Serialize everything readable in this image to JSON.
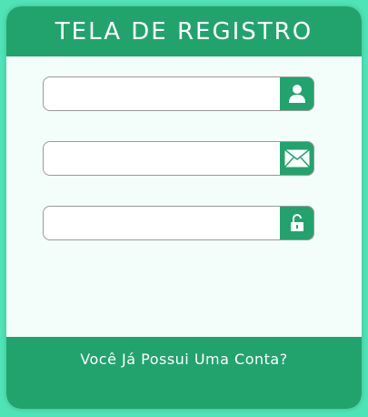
{
  "header": {
    "title": "TELA DE REGISTRO"
  },
  "fields": [
    {
      "name": "username",
      "value": "",
      "placeholder": "",
      "icon": "user-icon"
    },
    {
      "name": "email",
      "value": "",
      "placeholder": "",
      "icon": "envelope-icon"
    },
    {
      "name": "password",
      "value": "",
      "placeholder": "",
      "icon": "unlock-icon"
    }
  ],
  "footer": {
    "link_text": "Você Já Possui Uma Conta?"
  },
  "colors": {
    "background": "#4fe3b6",
    "accent": "#22a36e",
    "card": "#f3fdfa"
  }
}
